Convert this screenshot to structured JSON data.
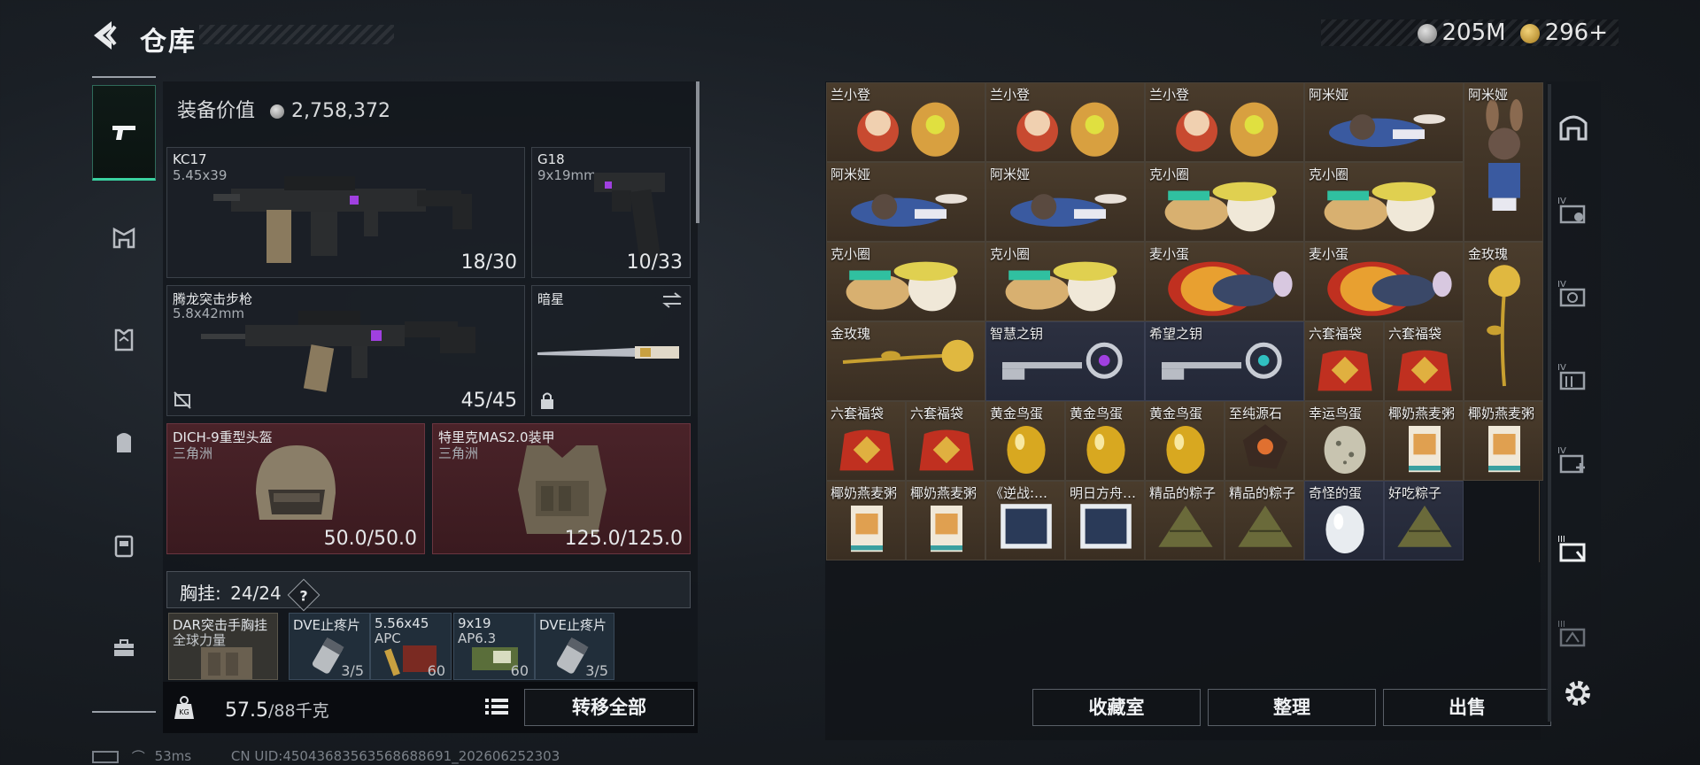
{
  "header": {
    "title": "仓库"
  },
  "currency": [
    {
      "icon": "silver-coin-icon",
      "value": "205M"
    },
    {
      "icon": "gold-coin-icon",
      "value": "296+"
    }
  ],
  "equipment": {
    "value_label": "装备价值",
    "value": "2,758,372",
    "primary": {
      "name": "KC17",
      "ammo": "5.45x39",
      "count": "18/30"
    },
    "pistol": {
      "name": "G18",
      "ammo": "9x19mm",
      "count": "10/33"
    },
    "secondary": {
      "name": "腾龙突击步枪",
      "ammo": "5.8x42mm",
      "count": "45/45"
    },
    "melee": {
      "name": "暗星"
    },
    "helmet": {
      "name": "DICH-9重型头盔",
      "sub": "三角洲",
      "count": "50.0/50.0"
    },
    "armor": {
      "name": "特里克MAS2.0装甲",
      "sub": "三角洲",
      "count": "125.0/125.0"
    },
    "chest": {
      "label": "胸挂:",
      "count": "24/24",
      "help": "?"
    },
    "chest_items": [
      {
        "name": "DAR突击手胸挂",
        "sub": "全球力量",
        "count": ""
      },
      {
        "name": "DVE止疼片",
        "sub": "",
        "count": "3/5"
      },
      {
        "name": "5.56x45",
        "sub": "APC",
        "count": "60"
      },
      {
        "name": "9x19",
        "sub": "AP6.3",
        "count": "60"
      },
      {
        "name": "DVE止疼片",
        "sub": "",
        "count": "3/5"
      }
    ],
    "weight": "57.5",
    "weight_max": "/88千克",
    "transfer_all": "转移全部"
  },
  "status": {
    "ping": "53ms",
    "uid": "CN UID:45043683563568688691_202606252303"
  },
  "grid": {
    "items": [
      {
        "label": "兰小登",
        "type": "lan",
        "bg": "brown"
      },
      {
        "label": "兰小登",
        "type": "lan",
        "bg": "brown"
      },
      {
        "label": "兰小登",
        "type": "lan",
        "bg": "brown"
      },
      {
        "label": "阿米娅",
        "type": "amiya",
        "bg": "brown"
      },
      {
        "label": "阿米娅",
        "type": "amiya_tall",
        "bg": "brown"
      },
      {
        "label": "阿米娅",
        "type": "amiya",
        "bg": "brown"
      },
      {
        "label": "阿米娅",
        "type": "amiya",
        "bg": "brown"
      },
      {
        "label": "克小圈",
        "type": "ke",
        "bg": "brown"
      },
      {
        "label": "克小圈",
        "type": "ke",
        "bg": "brown"
      },
      {
        "label": "克小圈",
        "type": "ke",
        "bg": "brown"
      },
      {
        "label": "克小圈",
        "type": "ke",
        "bg": "brown"
      },
      {
        "label": "麦小蛋",
        "type": "mai",
        "bg": "brown"
      },
      {
        "label": "麦小蛋",
        "type": "mai",
        "bg": "brown"
      },
      {
        "label": "金玫瑰",
        "type": "rose_tall",
        "bg": "brown"
      },
      {
        "label": "金玫瑰",
        "type": "rose",
        "bg": "brown"
      },
      {
        "label": "智慧之钥",
        "type": "key_purple",
        "bg": "blue"
      },
      {
        "label": "希望之钥",
        "type": "key_teal",
        "bg": "blue"
      },
      {
        "label": "六套福袋",
        "type": "bag",
        "bg": "brown"
      },
      {
        "label": "六套福袋",
        "type": "bag",
        "bg": "brown"
      },
      {
        "label": "六套福袋",
        "type": "bag",
        "bg": "brown"
      },
      {
        "label": "六套福袋",
        "type": "bag",
        "bg": "brown"
      },
      {
        "label": "黄金鸟蛋",
        "type": "gold_egg",
        "bg": "brown"
      },
      {
        "label": "黄金鸟蛋",
        "type": "gold_egg",
        "bg": "brown"
      },
      {
        "label": "黄金鸟蛋",
        "type": "gold_egg",
        "bg": "brown"
      },
      {
        "label": "至纯源石",
        "type": "stone",
        "bg": "brown"
      },
      {
        "label": "幸运鸟蛋",
        "type": "lucky_egg",
        "bg": "brown"
      },
      {
        "label": "椰奶燕麦粥",
        "type": "porridge",
        "bg": "brown"
      },
      {
        "label": "椰奶燕麦粥",
        "type": "porridge",
        "bg": "brown"
      },
      {
        "label": "椰奶燕麦粥",
        "type": "porridge",
        "bg": "brown"
      },
      {
        "label": "椰奶燕麦粥",
        "type": "porridge",
        "bg": "brown"
      },
      {
        "label": "《逆战:…",
        "type": "book",
        "bg": "brown"
      },
      {
        "label": "明日方舟…",
        "type": "book",
        "bg": "brown"
      },
      {
        "label": "精品的粽子",
        "type": "zongzi",
        "bg": "brown"
      },
      {
        "label": "精品的粽子",
        "type": "zongzi",
        "bg": "brown"
      },
      {
        "label": "奇怪的蛋",
        "type": "white_egg",
        "bg": "blue"
      },
      {
        "label": "好吃粽子",
        "type": "zongzi",
        "bg": "blue"
      }
    ]
  },
  "actions": {
    "collection": "收藏室",
    "sort": "整理",
    "sell": "出售"
  },
  "colors": {
    "accent": "#3ad1a0",
    "red_slot": "#4a2329",
    "brown_cell": "#4a3c2c",
    "blue_cell": "#2c3040"
  }
}
